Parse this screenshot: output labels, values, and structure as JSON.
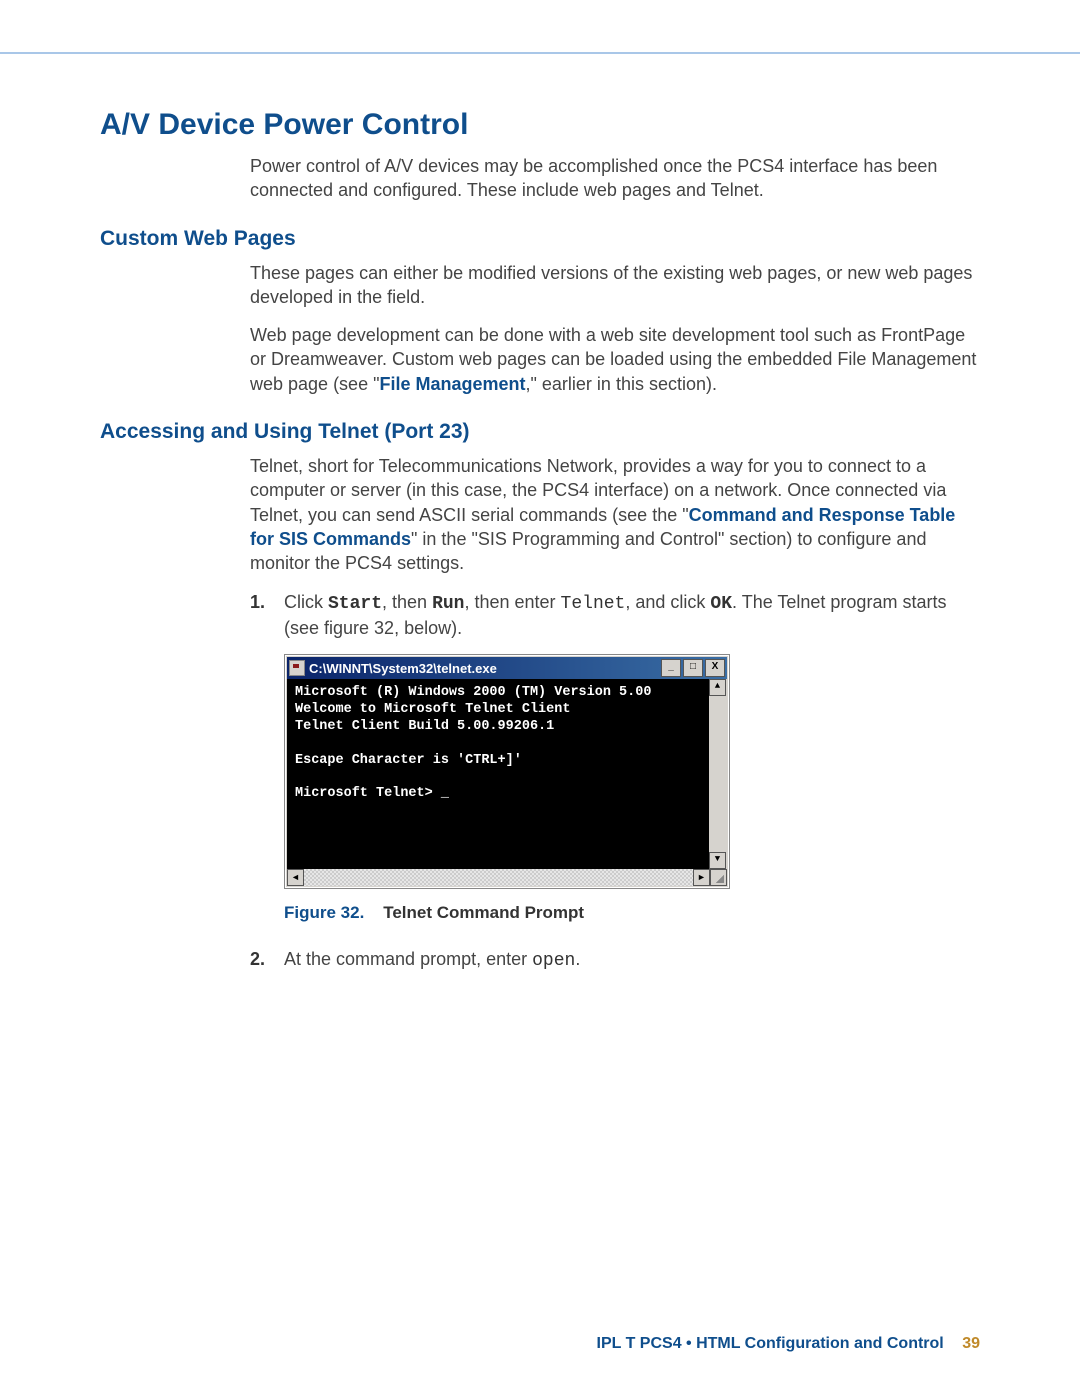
{
  "h1": "A/V Device Power Control",
  "p1": "Power control of A/V devices may be accomplished once the PCS4 interface has been connected and configured. These include web pages and Telnet.",
  "h2a": "Custom Web Pages",
  "p2": "These pages can either be modified versions of the existing web pages, or new web pages developed in the field.",
  "p3a": "Web page development can be done with a web site development tool such as FrontPage or Dreamweaver. Custom web pages can be loaded using the embedded File Management web page (see \"",
  "p3link": "File Management",
  "p3b": ",\" earlier in this section).",
  "h2b": "Accessing and Using Telnet (Port 23)",
  "p4a": "Telnet, short for Telecommunications Network, provides a way for you to connect to a computer or server (in this case, the PCS4 interface) on a network. Once connected via Telnet, you can send ASCII serial commands (see the \"",
  "p4link": "Command and Response Table for SIS Commands",
  "p4b": "\" in the \"SIS Programming and Control\" section) to configure and monitor the PCS4 settings.",
  "step1_num": "1.",
  "step1_a": "Click ",
  "step1_start": "Start",
  "step1_b": ", then ",
  "step1_run": "Run",
  "step1_c": ", then enter ",
  "step1_telnet": "Telnet",
  "step1_d": ", and click ",
  "step1_ok": "OK",
  "step1_e": ". The Telnet program starts (see figure 32, below).",
  "telnet_title": "C:\\WINNT\\System32\\telnet.exe",
  "telnet_body": "Microsoft (R) Windows 2000 (TM) Version 5.00\nWelcome to Microsoft Telnet Client\nTelnet Client Build 5.00.99206.1\n\nEscape Character is 'CTRL+]'\n\nMicrosoft Telnet> _",
  "btn_min": "_",
  "btn_max": "□",
  "btn_close": "X",
  "arr_up": "▲",
  "arr_dn": "▼",
  "arr_l": "◄",
  "arr_r": "►",
  "fig_label": "Figure 32.",
  "fig_title": "Telnet Command Prompt",
  "step2_num": "2.",
  "step2_a": "At the command prompt, enter ",
  "step2_open": "open",
  "step2_b": ".",
  "footer_text": "IPL T PCS4 • HTML Configuration and Control",
  "footer_page": "39"
}
